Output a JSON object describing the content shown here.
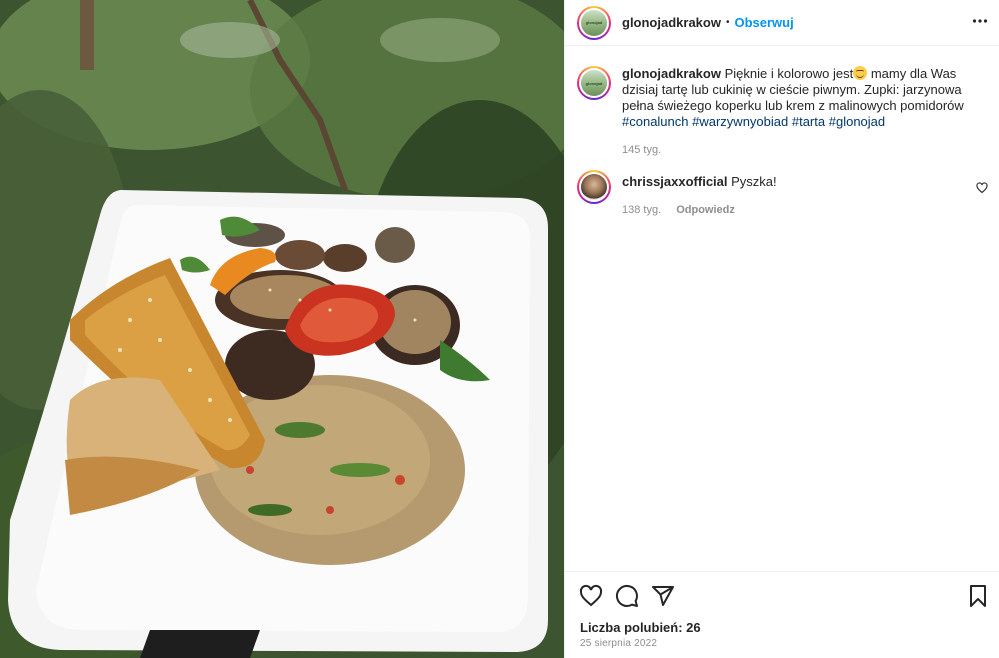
{
  "post": {
    "author": "glonojadkrakow",
    "follow_label": "Obserwuj",
    "separator": "•",
    "avatar_text": "glonojad"
  },
  "caption": {
    "author": "glonojadkrakow",
    "text_before_emoji": "Pięknie i kolorowo jest",
    "text_after_emoji": " mamy dla Was dzisiaj tartę lub cukinię w cieście piwnym. Zupki: jarzynowa pełna świeżego koperku lub krem z malinowych pomidorów",
    "hashtags": [
      "#conalunch",
      "#warzywnyobiad",
      "#tarta",
      "#glonojad"
    ],
    "time": "145 tyg."
  },
  "comments": [
    {
      "author": "chrissjaxxofficial",
      "text": "Pyszka!",
      "time": "138 tyg.",
      "reply_label": "Odpowiedz"
    }
  ],
  "footer": {
    "likes": "Liczba polubień: 26",
    "date": "25 sierpnia 2022"
  },
  "icons": {
    "like": "heart-icon",
    "comment": "comment-icon",
    "share": "send-icon",
    "save": "bookmark-icon",
    "more": "more-icon"
  },
  "colors": {
    "link": "#0095f6",
    "hashtag": "#00376b",
    "muted": "#8e8e8e",
    "text": "#262626",
    "emoji": "#ffcc4d"
  }
}
